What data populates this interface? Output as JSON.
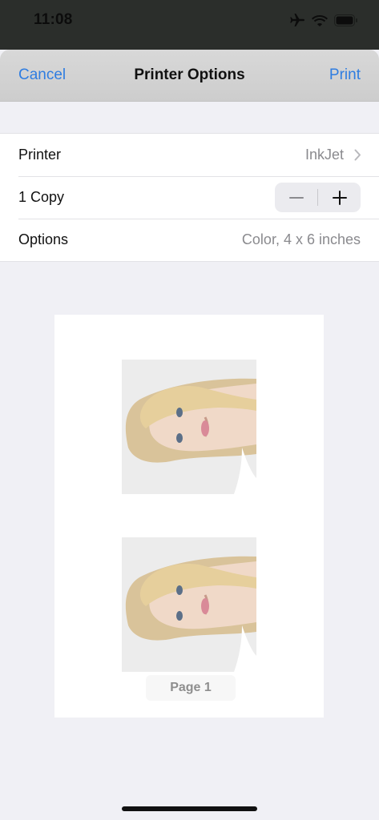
{
  "status_bar": {
    "time": "11:08",
    "icons": [
      "airplane-icon",
      "wifi-icon",
      "battery-icon"
    ]
  },
  "navbar": {
    "cancel_label": "Cancel",
    "title": "Printer Options",
    "print_label": "Print"
  },
  "settings": {
    "printer": {
      "label": "Printer",
      "value": "InkJet"
    },
    "copies": {
      "label": "1 Copy",
      "decrement": "minus-icon",
      "increment": "plus-icon"
    },
    "options": {
      "label": "Options",
      "value": "Color, 4 x 6 inches"
    }
  },
  "preview": {
    "page_label": "Page 1",
    "photos": [
      "portrait-photo",
      "portrait-photo"
    ]
  },
  "colors": {
    "accent": "#2f7de1",
    "secondary_text": "#8a8a8e",
    "background": "#f0f0f5"
  }
}
